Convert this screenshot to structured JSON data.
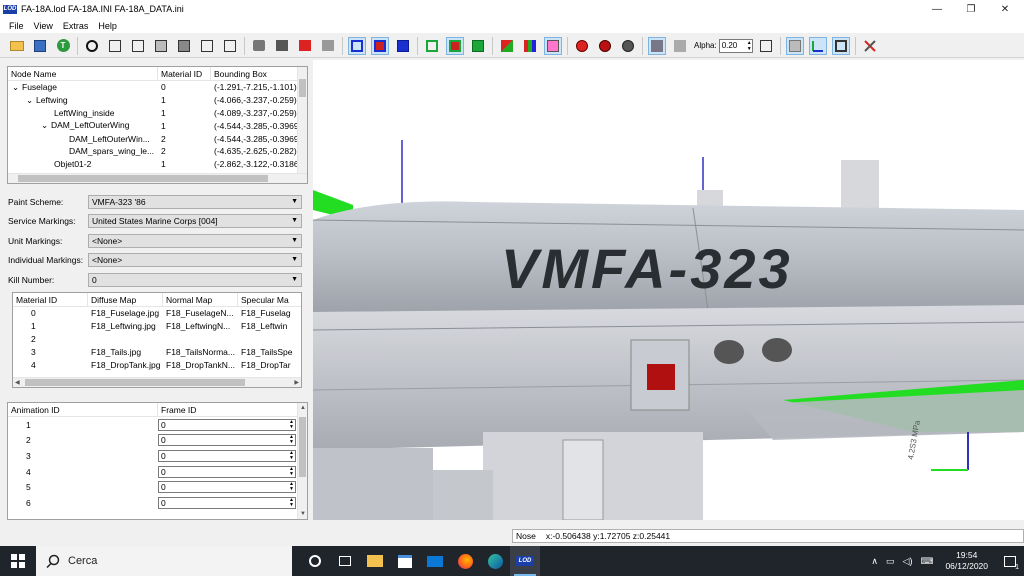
{
  "window": {
    "app_icon_text": "LOD",
    "title": "FA-18A.lod  FA-18A.INI  FA-18A_DATA.ini",
    "minimize": "—",
    "maximize": "❐",
    "close": "✕"
  },
  "menu": [
    "File",
    "View",
    "Extras",
    "Help"
  ],
  "toolbar": {
    "alpha_label": "Alpha:",
    "alpha_value": "0.20"
  },
  "node_tree": {
    "headers": [
      "Node Name",
      "Material ID",
      "Bounding Box"
    ],
    "rows": [
      {
        "expander": "⌄",
        "name": "Fuselage",
        "material": "0",
        "bbox": "(-1.291,-7.215,-1.101)"
      },
      {
        "expander": "⌄",
        "name": "Leftwing",
        "material": "1",
        "bbox": "(-4.066,-3.237,-0.259)"
      },
      {
        "expander": "",
        "name": "LeftWing_inside",
        "material": "1",
        "bbox": "(-4.089,-3.237,-0.259)"
      },
      {
        "expander": "⌄",
        "name": "DAM_LeftOuterWing",
        "material": "1",
        "bbox": "(-4.544,-3.285,-0.3969"
      },
      {
        "expander": "",
        "name": "DAM_LeftOuterWin...",
        "material": "2",
        "bbox": "(-4.544,-3.285,-0.3969"
      },
      {
        "expander": "",
        "name": "DAM_spars_wing_le...",
        "material": "2",
        "bbox": "(-4.635,-2.625,-0.282)"
      },
      {
        "expander": "",
        "name": "Objet01-2",
        "material": "1",
        "bbox": "(-2.862,-3.122,-0.3186"
      }
    ]
  },
  "markings": [
    {
      "label": "Paint Scheme:",
      "value": "VMFA-323 '86"
    },
    {
      "label": "Service Markings:",
      "value": "United States Marine Corps [004]"
    },
    {
      "label": "Unit Markings:",
      "value": "<None>"
    },
    {
      "label": "Individual Markings:",
      "value": "<None>"
    },
    {
      "label": "Kill Number:",
      "value": "0"
    }
  ],
  "materials": {
    "headers": [
      "Material ID",
      "Diffuse Map",
      "Normal Map",
      "Specular Ma"
    ],
    "rows": [
      {
        "id": "0",
        "diffuse": "F18_Fuselage.jpg",
        "normal": "F18_FuselageN...",
        "specular": "F18_Fuselag"
      },
      {
        "id": "1",
        "diffuse": "F18_Leftwing.jpg",
        "normal": "F18_LeftwingN...",
        "specular": "F18_Leftwin"
      },
      {
        "id": "2",
        "diffuse": "",
        "normal": "",
        "specular": ""
      },
      {
        "id": "3",
        "diffuse": "F18_Tails.jpg",
        "normal": "F18_TailsNorma...",
        "specular": "F18_TailsSpe"
      },
      {
        "id": "4",
        "diffuse": "F18_DropTank.jpg",
        "normal": "F18_DropTankN...",
        "specular": "F18_DropTar"
      }
    ]
  },
  "animations": {
    "headers": [
      "Animation ID",
      "Frame ID"
    ],
    "rows": [
      {
        "id": "1",
        "frame": "0"
      },
      {
        "id": "2",
        "frame": "0"
      },
      {
        "id": "3",
        "frame": "0"
      },
      {
        "id": "4",
        "frame": "0"
      },
      {
        "id": "5",
        "frame": "0"
      },
      {
        "id": "6",
        "frame": "0"
      }
    ]
  },
  "viewport": {
    "squadron_text": "VMFA-323",
    "bottom_decal": "4.2S3 MPa"
  },
  "status": {
    "node": "Nose",
    "coords": "x:-0.506438 y:1.72705 z:0.25441"
  },
  "taskbar": {
    "search_placeholder": "Cerca",
    "time": "19:54",
    "date": "06/12/2020",
    "notification_count": "1",
    "lod_label": "LOD"
  },
  "colors": {
    "selection_blue": "#cce4f7",
    "taskbar": "#20242b",
    "wing_green": "#22dd22"
  }
}
